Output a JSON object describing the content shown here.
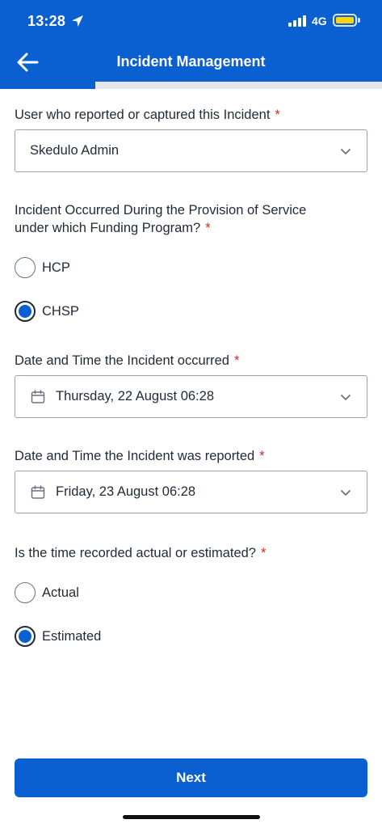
{
  "status_bar": {
    "time": "13:28",
    "network": "4G"
  },
  "nav": {
    "title": "Incident Management",
    "back_icon": "arrow-left-icon"
  },
  "progress": {
    "fraction": 0.25
  },
  "colors": {
    "primary": "#0a5fd1",
    "required": "#e02424",
    "battery": "#ffd60a"
  },
  "form": {
    "reporter": {
      "label": "User who reported or captured this Incident",
      "required_mark": "*",
      "value": "Skedulo Admin"
    },
    "funding": {
      "label_line1": "Incident Occurred During the Provision of Service",
      "label_line2": "under which Funding Program?",
      "required_mark": "*",
      "options": [
        {
          "label": "HCP",
          "selected": false
        },
        {
          "label": "CHSP",
          "selected": true
        }
      ]
    },
    "occurred": {
      "label": "Date and Time the Incident occurred",
      "required_mark": "*",
      "value": "Thursday, 22 August 06:28"
    },
    "reported": {
      "label": "Date and Time the Incident was reported",
      "required_mark": "*",
      "value": "Friday, 23 August 06:28"
    },
    "time_type": {
      "label": "Is the time recorded actual or estimated?",
      "required_mark": "*",
      "options": [
        {
          "label": "Actual",
          "selected": false
        },
        {
          "label": "Estimated",
          "selected": true
        }
      ]
    }
  },
  "footer": {
    "next_label": "Next"
  }
}
